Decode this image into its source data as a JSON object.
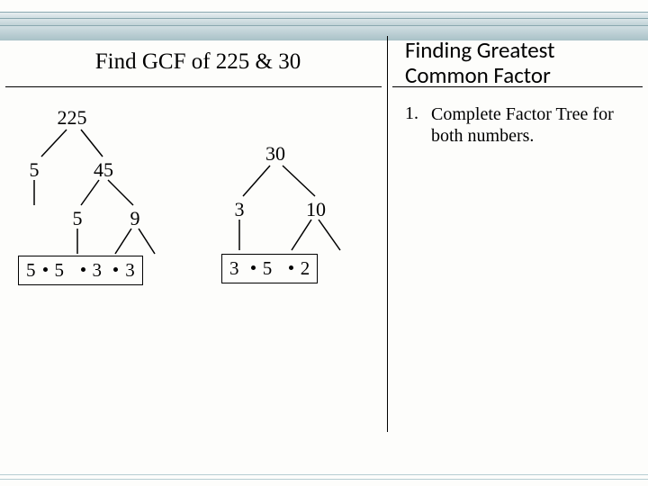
{
  "title_left": "Find GCF of 225 & 30",
  "title_right": "Finding Greatest Common Factor",
  "step": {
    "num": "1.",
    "text": "Complete Factor Tree for both numbers."
  },
  "tree225": {
    "root": "225",
    "l1_left": "5",
    "l1_right": "45",
    "l2_left": "5",
    "l2_right": "9",
    "primes": [
      "5",
      "5",
      "3",
      "3"
    ]
  },
  "tree30": {
    "root": "30",
    "l1_left": "3",
    "l1_right": "10",
    "primes": [
      "3",
      "5",
      "2"
    ]
  }
}
